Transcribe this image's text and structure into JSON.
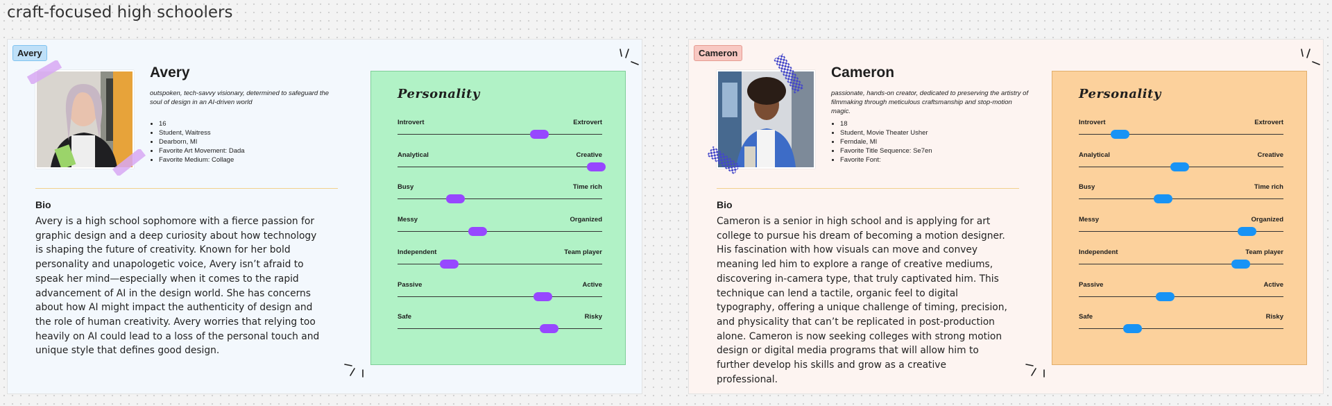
{
  "page_title": "craft-focused high schoolers",
  "personas": [
    {
      "tag": "Avery",
      "name": "Avery",
      "description": "outspoken, tech-savvy visionary, determined to safeguard the soul of design in an AI-driven world",
      "facts": [
        "16",
        "Student, Waitress",
        "Dearborn, MI",
        "Favorite Art Movement: Dada",
        "Favorite Medium: Collage"
      ],
      "bio_heading": "Bio",
      "bio": "Avery is a high school sophomore with a fierce passion for graphic design and a deep curiosity about how technology is shaping the future of creativity. Known for her bold personality and unapologetic voice, Avery isn’t afraid to speak her mind—especially when it comes to the rapid advancement of AI in the design world. She has concerns about how AI might impact the authenticity of design and the role of human creativity. Avery worries that relying too heavily on AI could lead to a loss of the personal touch and unique style that defines good design.",
      "panel_title": "Personality",
      "traits": [
        {
          "left": "Introvert",
          "right": "Extrovert",
          "value": 0.69
        },
        {
          "left": "Analytical",
          "right": "Creative",
          "value": 0.97
        },
        {
          "left": "Busy",
          "right": "Time rich",
          "value": 0.28
        },
        {
          "left": "Messy",
          "right": "Organized",
          "value": 0.39
        },
        {
          "left": "Independent",
          "right": "Team player",
          "value": 0.25
        },
        {
          "left": "Passive",
          "right": "Active",
          "value": 0.71
        },
        {
          "left": "Safe",
          "right": "Risky",
          "value": 0.74
        }
      ]
    },
    {
      "tag": "Cameron",
      "name": "Cameron",
      "description": "passionate, hands-on creator, dedicated to preserving the artistry of filmmaking through meticulous craftsmanship and stop-motion magic.",
      "facts": [
        "18",
        "Student, Movie Theater Usher",
        "Ferndale, MI",
        "Favorite Title Sequence: Se7en",
        "Favorite Font:"
      ],
      "bio_heading": "Bio",
      "bio": "Cameron is a senior in high school and is applying for art college to pursue his dream of becoming a motion designer. His fascination with how visuals can move and convey meaning led him to explore a range of creative mediums, discovering in-camera type, that truly captivated him. This technique can lend a tactile, organic feel to digital typography, offering a unique challenge of timing, precision, and physicality that can’t be replicated in post-production alone. Cameron is now seeking colleges with strong motion design or digital media programs that will allow him to further develop his skills and grow as a creative professional.",
      "panel_title": "Personality",
      "traits": [
        {
          "left": "Introvert",
          "right": "Extrovert",
          "value": 0.2
        },
        {
          "left": "Analytical",
          "right": "Creative",
          "value": 0.49
        },
        {
          "left": "Busy",
          "right": "Time rich",
          "value": 0.41
        },
        {
          "left": "Messy",
          "right": "Organized",
          "value": 0.82
        },
        {
          "left": "Independent",
          "right": "Team player",
          "value": 0.79
        },
        {
          "left": "Passive",
          "right": "Active",
          "value": 0.42
        },
        {
          "left": "Safe",
          "right": "Risky",
          "value": 0.26
        }
      ]
    }
  ],
  "colors": {
    "avery_knob": "#9747ff",
    "cameron_knob": "#1893f5",
    "avery_panel": "#b1f2c6",
    "cameron_panel": "#fcd19c"
  }
}
